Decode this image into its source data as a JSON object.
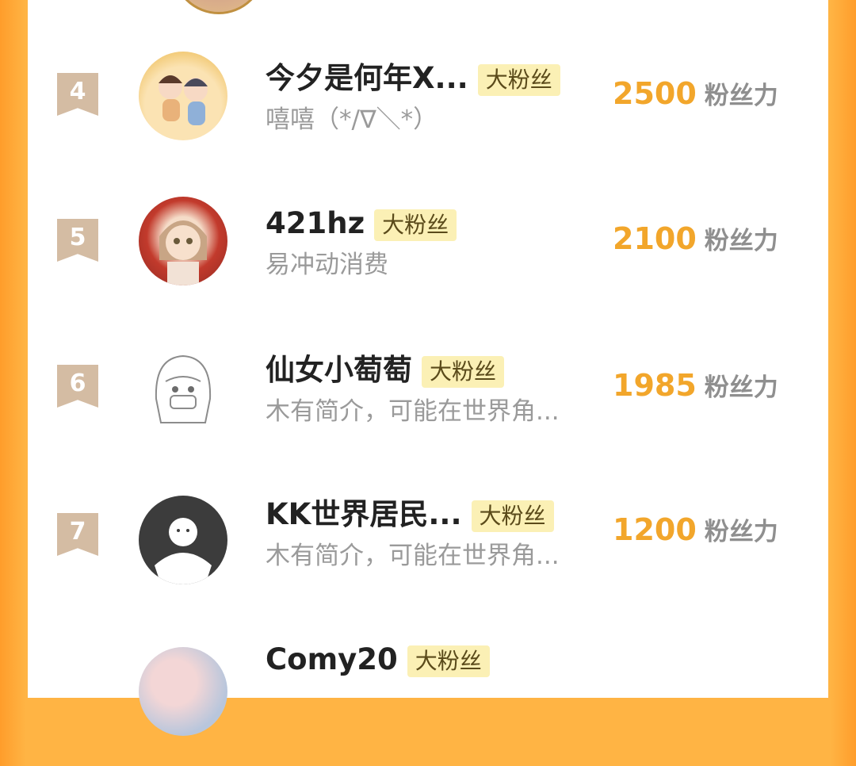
{
  "leaderboard": {
    "rows": [
      {
        "rank": "4",
        "name": "今夕是何年X...",
        "badge": "大粉丝",
        "bio": "嘻嘻（*/∇＼*）",
        "score": "2500",
        "unit": "粉丝力"
      },
      {
        "rank": "5",
        "name": "421hz",
        "badge": "大粉丝",
        "bio": "易冲动消费",
        "score": "2100",
        "unit": "粉丝力"
      },
      {
        "rank": "6",
        "name": "仙女小萄萄",
        "badge": "大粉丝",
        "bio": "木有简介，可能在世界角...",
        "score": "1985",
        "unit": "粉丝力"
      },
      {
        "rank": "7",
        "name": "KK世界居民...",
        "badge": "大粉丝",
        "bio": "木有简介，可能在世界角...",
        "score": "1200",
        "unit": "粉丝力"
      },
      {
        "rank": "",
        "name": "Comy20",
        "badge": "大粉丝",
        "bio": "",
        "score": "",
        "unit": ""
      }
    ]
  }
}
